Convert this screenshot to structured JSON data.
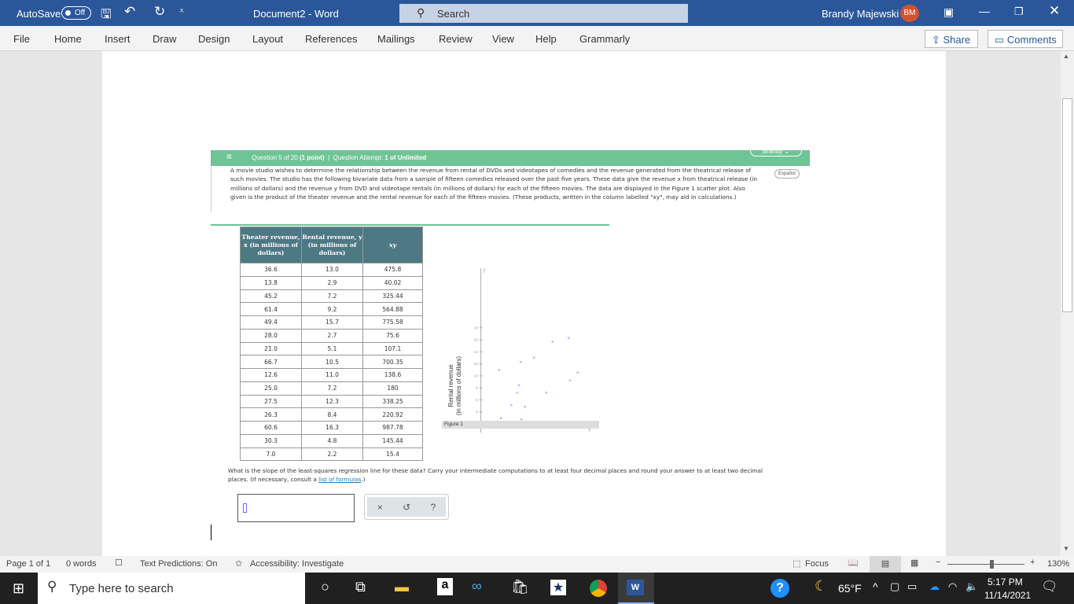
{
  "titlebar": {
    "autosave": "AutoSave",
    "autosave_state": "Off",
    "doc_title": "Document2  -  Word",
    "search": "Search",
    "user": "Brandy Majewski",
    "initials": "BM"
  },
  "ribbon": {
    "tabs": [
      "File",
      "Home",
      "Insert",
      "Draw",
      "Design",
      "Layout",
      "References",
      "Mailings",
      "Review",
      "View",
      "Help",
      "Grammarly"
    ],
    "share": "Share",
    "comments": "Comments"
  },
  "question": {
    "header": "Question 5 of 20",
    "points": "(1 point)",
    "attempt_label": "Question Attempt:",
    "attempt": "1 of Unlimited",
    "user_menu": "Brandy",
    "espanol": "Español",
    "paragraph": "A movie studio wishes to determine the relationship between the revenue from rental of DVDs and videotapes of comedies and the revenue generated from the theatrical release of such movies. The studio has the following bivariate data from a sample of fifteen comedies released over the past five years. These data give the revenue x from theatrical release (in millions of dollars) and the revenue y from DVD and videotape rentals (in millions of dollars) for each of the fifteen movies. The data are displayed in the Figure 1 scatter plot. Also given is the product of the theater revenue and the rental revenue for each of the fifteen movies. (These products, written in the column labelled \"xy\", may aid in calculations.)",
    "prompt": "What is the slope of the least-squares regression line for these data? Carry your intermediate computations to at least four decimal places and round your answer to at least two decimal places. (If necessary, consult a ",
    "link": "list of formulas",
    "prompt_end": ".)",
    "buttons": {
      "clear": "×",
      "undo": "↺",
      "help": "?"
    }
  },
  "table": {
    "headers": [
      "Theater revenue, x (in millions of dollars)",
      "Rental revenue, y (in millions of dollars)",
      "xy"
    ],
    "rows": [
      [
        "36.6",
        "13.0",
        "475.8"
      ],
      [
        "13.8",
        "2.9",
        "40.02"
      ],
      [
        "45.2",
        "7.2",
        "325.44"
      ],
      [
        "61.4",
        "9.2",
        "564.88"
      ],
      [
        "49.4",
        "15.7",
        "775.58"
      ],
      [
        "28.0",
        "2.7",
        "75.6"
      ],
      [
        "21.0",
        "5.1",
        "107.1"
      ],
      [
        "66.7",
        "10.5",
        "700.35"
      ],
      [
        "12.6",
        "11.0",
        "138.6"
      ],
      [
        "25.0",
        "7.2",
        "180"
      ],
      [
        "27.5",
        "12.3",
        "338.25"
      ],
      [
        "26.3",
        "8.4",
        "220.92"
      ],
      [
        "60.6",
        "16.3",
        "987.78"
      ],
      [
        "30.3",
        "4.8",
        "145.44"
      ],
      [
        "7.0",
        "2.2",
        "15.4"
      ]
    ]
  },
  "chart_data": {
    "type": "scatter",
    "xlabel": "Theater revenue (in millions of dollars)",
    "ylabel": "Rental revenue (in millions of dollars)",
    "x_axis_letter": "x",
    "y_axis_letter": "y",
    "caption": "Figure 1",
    "xlim": [
      0,
      75
    ],
    "ylim": [
      0,
      19
    ],
    "xticks": [
      10,
      20,
      30,
      40,
      50,
      60,
      70
    ],
    "yticks": [
      2,
      4,
      6,
      8,
      10,
      12,
      14,
      16,
      18
    ],
    "origin_label": "0",
    "marker_color": "#6b6bff",
    "x": [
      36.6,
      13.8,
      45.2,
      61.4,
      49.4,
      28.0,
      21.0,
      66.7,
      12.6,
      25.0,
      27.5,
      26.3,
      60.6,
      30.3,
      7.0
    ],
    "y": [
      13.0,
      2.9,
      7.2,
      9.2,
      15.7,
      2.7,
      5.1,
      10.5,
      11.0,
      7.2,
      12.3,
      8.4,
      16.3,
      4.8,
      2.2
    ]
  },
  "status": {
    "page": "Page 1 of 1",
    "words": "0 words",
    "predictions": "Text Predictions: On",
    "accessibility": "Accessibility: Investigate",
    "focus": "Focus",
    "zoom": "130%",
    "zoom_level": 130
  },
  "taskbar": {
    "search": "Type here to search",
    "weather": "65°F",
    "time": "5:17 PM",
    "date": "11/14/2021"
  }
}
